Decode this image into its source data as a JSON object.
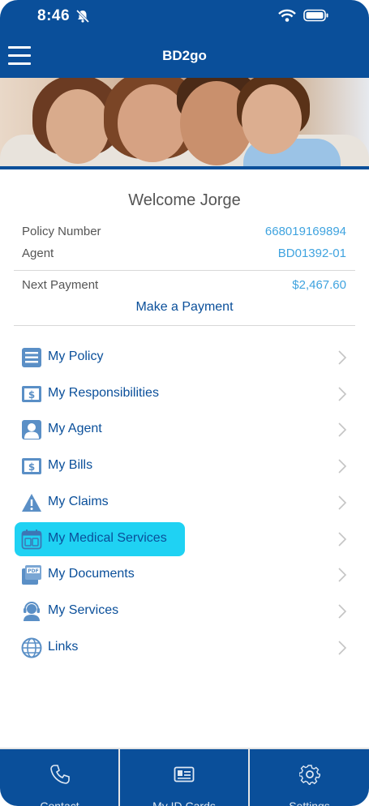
{
  "status": {
    "time": "8:46"
  },
  "nav": {
    "title": "BD2go"
  },
  "welcome": "Welcome Jorge",
  "policy": {
    "label": "Policy Number",
    "value": "668019169894"
  },
  "agent": {
    "label": "Agent",
    "value": "BD01392-01"
  },
  "payment": {
    "label": "Next Payment",
    "value": "$2,467.60",
    "action": "Make a Payment"
  },
  "menu": [
    {
      "label": "My Policy",
      "icon": "document-icon"
    },
    {
      "label": "My Responsibilities",
      "icon": "dollar-bill-icon"
    },
    {
      "label": "My Agent",
      "icon": "person-icon"
    },
    {
      "label": "My Bills",
      "icon": "dollar-bill-icon"
    },
    {
      "label": "My Claims",
      "icon": "warning-icon"
    },
    {
      "label": "My Medical Services",
      "icon": "calendar-icon"
    },
    {
      "label": "My Documents",
      "icon": "pdf-icon"
    },
    {
      "label": "My Services",
      "icon": "headset-icon"
    },
    {
      "label": "Links",
      "icon": "globe-icon"
    }
  ],
  "tabs": [
    {
      "label": "Contact",
      "icon": "phone-icon"
    },
    {
      "label": "My ID Cards",
      "icon": "id-card-icon"
    },
    {
      "label": "Settings",
      "icon": "gear-icon"
    }
  ],
  "colors": {
    "brand": "#0a4f9a",
    "accent": "#3fa3df",
    "highlight": "#1fd2f3"
  }
}
